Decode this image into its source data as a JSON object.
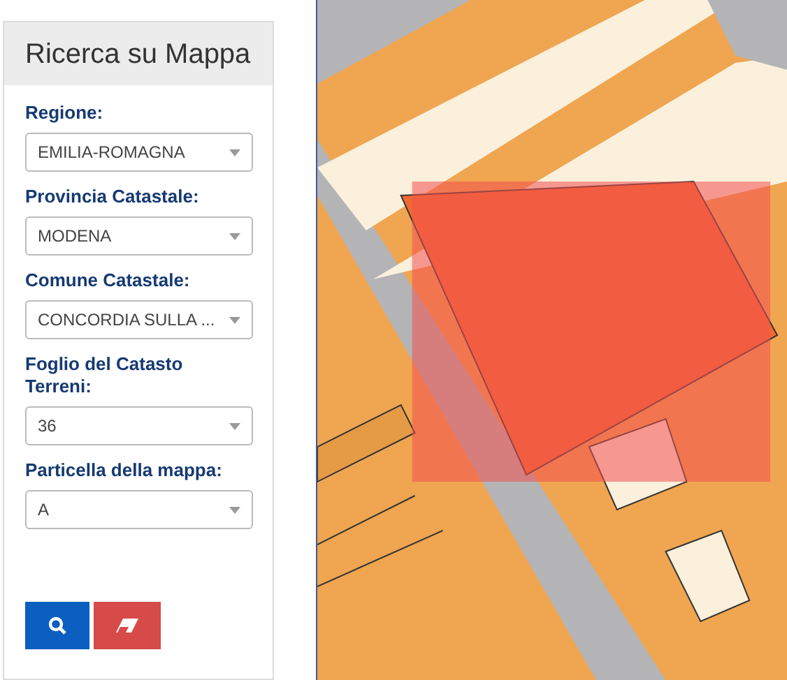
{
  "panel": {
    "title": "Ricerca su Mappa"
  },
  "fields": [
    {
      "label": "Regione:",
      "value": "EMILIA-ROMAGNA"
    },
    {
      "label": "Provincia Catastale:",
      "value": "MODENA"
    },
    {
      "label": "Comune Catastale:",
      "value": "CONCORDIA SULLA ..."
    },
    {
      "label": "Foglio del Catasto Terreni:",
      "value": "36"
    },
    {
      "label": "Particella della mappa:",
      "value": "A"
    }
  ],
  "buttons": [
    {
      "kind": "search"
    },
    {
      "kind": "clear"
    }
  ]
}
